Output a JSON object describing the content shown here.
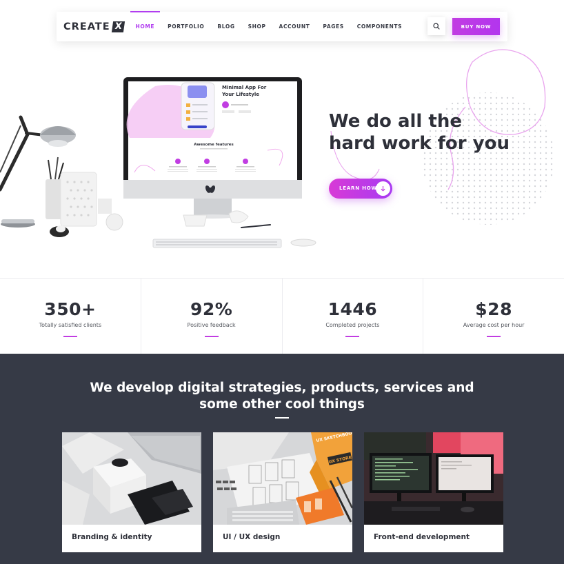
{
  "navbar": {
    "logo_text": "CREATE",
    "logo_mark": "X",
    "links": [
      {
        "label": "HOME",
        "active": true
      },
      {
        "label": "PORTFOLIO",
        "active": false
      },
      {
        "label": "BLOG",
        "active": false
      },
      {
        "label": "SHOP",
        "active": false
      },
      {
        "label": "ACCOUNT",
        "active": false
      },
      {
        "label": "PAGES",
        "active": false
      },
      {
        "label": "COMPONENTS",
        "active": false
      }
    ],
    "search_icon": "search-icon",
    "buy_label": "BUY NOW"
  },
  "hero": {
    "title_line1": "We do all the",
    "title_line2": "hard work for you",
    "button_label": "LEARN HOW",
    "button_icon": "arrow-down-icon",
    "screen": {
      "headline_line1": "Minimal App For",
      "headline_line2": "Your Lifestyle",
      "features_title": "Awesome features"
    }
  },
  "stats": [
    {
      "value": "350+",
      "label": "Totally satisfied clients"
    },
    {
      "value": "92%",
      "label": "Positive feedback"
    },
    {
      "value": "1446",
      "label": "Completed projects"
    },
    {
      "value": "$28",
      "label": "Average cost per hour"
    }
  ],
  "services": {
    "title_line1": "We develop digital strategies, products, services and",
    "title_line2": "some other cool things",
    "cards": [
      {
        "label": "Branding & identity"
      },
      {
        "label": "UI / UX design",
        "image_text_1": "UX SKETCHBOOK",
        "image_text_2": "UX STORE"
      },
      {
        "label": "Front-end development"
      }
    ]
  },
  "colors": {
    "accent": "#b13df0",
    "accent_pink": "#d83ad6",
    "dark": "#2e3039",
    "dark_section": "#363a46"
  }
}
